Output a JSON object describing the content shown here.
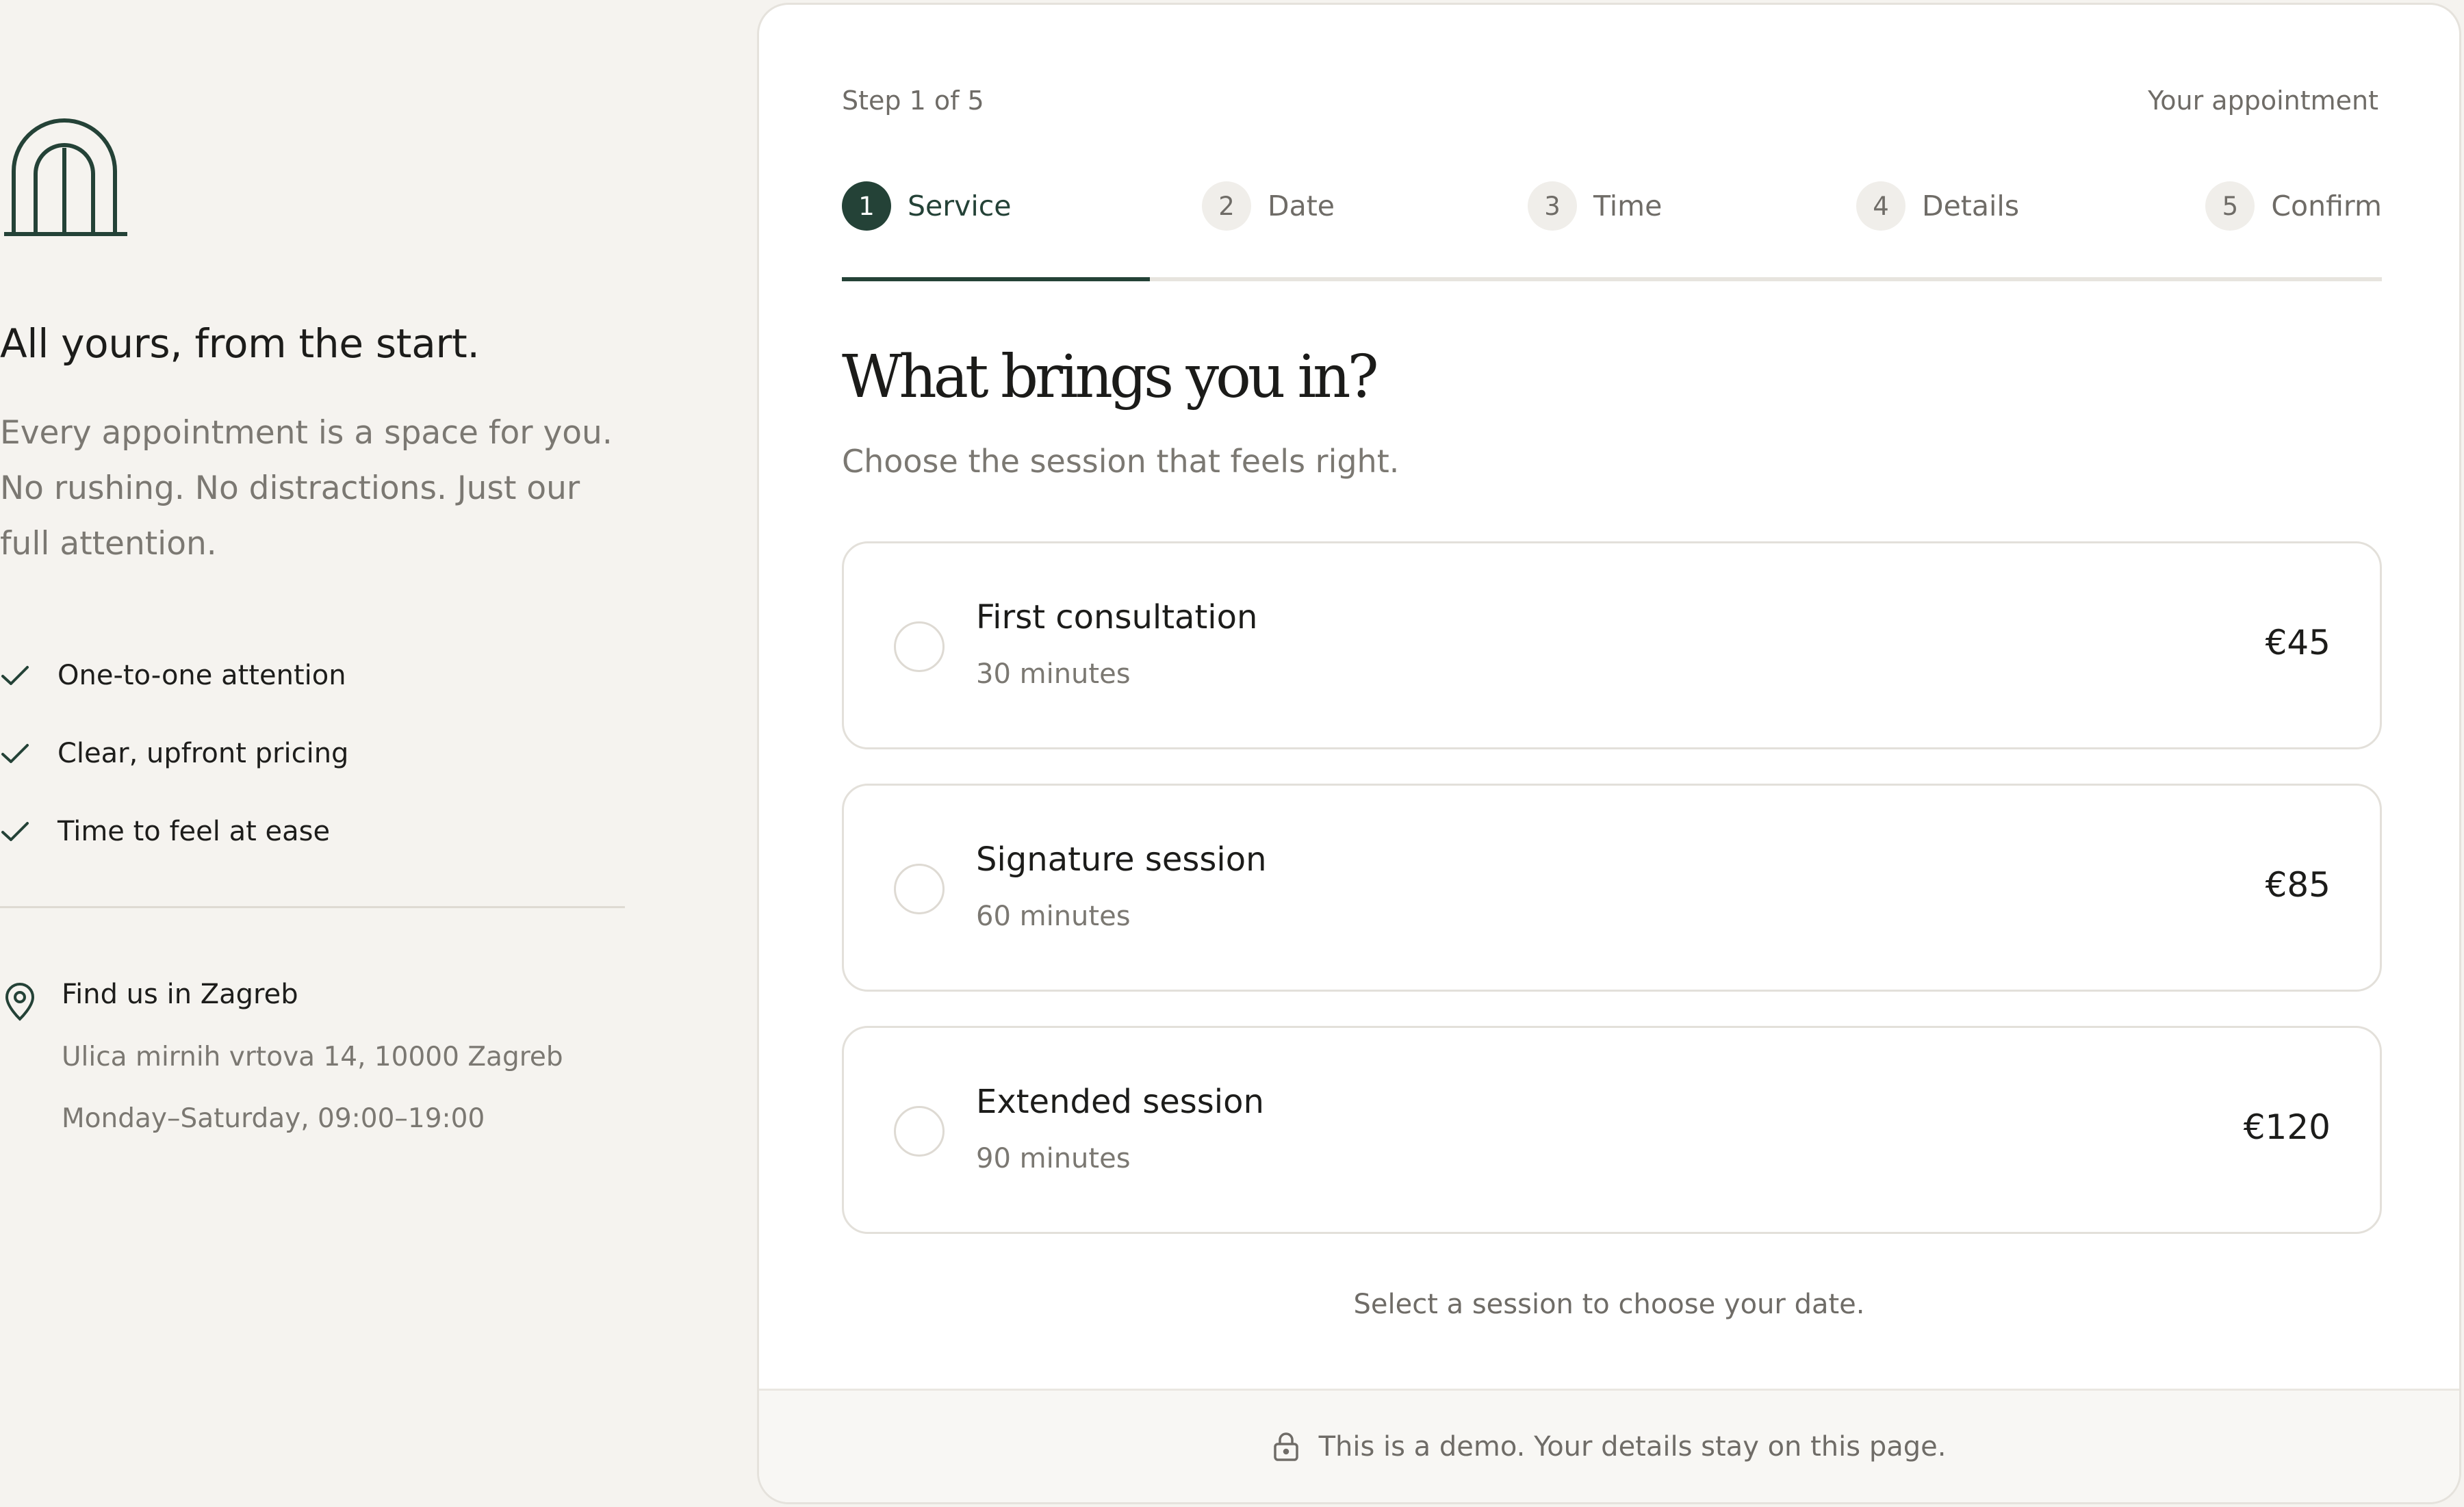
{
  "brand": {
    "logo_icon": "arch-logo-icon",
    "accent": "#244237"
  },
  "left": {
    "tagline": "All yours, from the start.",
    "intro_lines": [
      "Every appointment is a space for you.",
      "No rushing. No distractions. Just our",
      "full attention."
    ],
    "features": [
      {
        "icon": "check-icon",
        "label": "One-to-one attention"
      },
      {
        "icon": "check-icon",
        "label": "Clear, upfront pricing"
      },
      {
        "icon": "check-icon",
        "label": "Time to feel at ease"
      }
    ],
    "location": {
      "icon": "map-pin-icon",
      "title": "Find us in Zagreb",
      "address": "Ulica mirnih vrtova 14, 10000 Zagreb",
      "hours": "Monday–Saturday, 09:00–19:00"
    }
  },
  "card": {
    "step_count": "Step 1 of 5",
    "your_appointment": "Your appointment",
    "steps": [
      {
        "num": "1",
        "label": "Service",
        "active": true
      },
      {
        "num": "2",
        "label": "Date",
        "active": false
      },
      {
        "num": "3",
        "label": "Time",
        "active": false
      },
      {
        "num": "4",
        "label": "Details",
        "active": false
      },
      {
        "num": "5",
        "label": "Confirm",
        "active": false
      }
    ],
    "progress_fraction": 0.2,
    "headline": "What brings you in?",
    "subhead": "Choose the session that feels right.",
    "options": [
      {
        "title": "First consultation",
        "duration": "30 minutes",
        "price": "€45",
        "selected": false
      },
      {
        "title": "Signature session",
        "duration": "60 minutes",
        "price": "€85",
        "selected": false
      },
      {
        "title": "Extended session",
        "duration": "90 minutes",
        "price": "€120",
        "selected": false
      }
    ],
    "hint": "Select a session to choose your date.",
    "footer": {
      "icon": "lock-icon",
      "text": "This is a demo. Your details stay on this page."
    }
  }
}
